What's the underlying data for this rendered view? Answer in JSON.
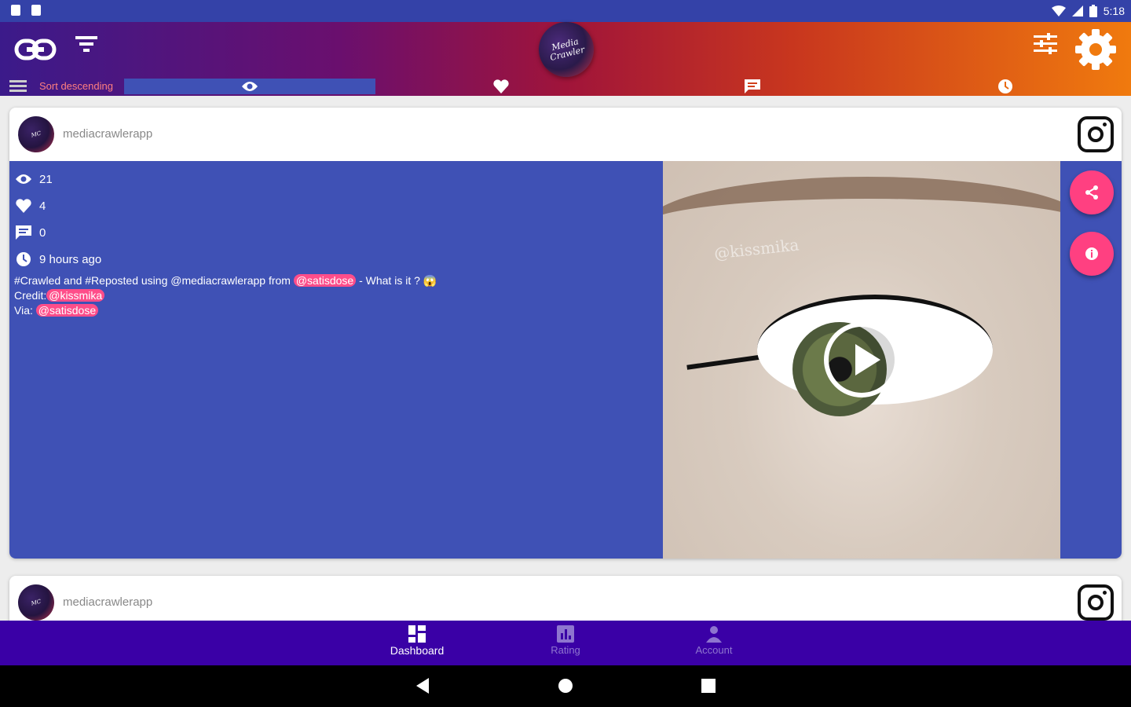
{
  "status_bar": {
    "time": "5:18",
    "left_icons": [
      "sd-card-icon",
      "notification-icon"
    ],
    "right_icons": [
      "wifi-icon",
      "signal-icon",
      "battery-icon"
    ]
  },
  "app_bar": {
    "logo_text": "Media Crawler",
    "left_icons": [
      "link-icon",
      "filter-icon"
    ],
    "right_icons": [
      "tune-icon",
      "gear-icon"
    ],
    "sort_label": "Sort descending",
    "sort_tabs": [
      {
        "name": "views",
        "icon": "eye-icon",
        "active": true
      },
      {
        "name": "likes",
        "icon": "heart-icon",
        "active": false
      },
      {
        "name": "comments",
        "icon": "comment-icon",
        "active": false
      },
      {
        "name": "time",
        "icon": "clock-icon",
        "active": false
      }
    ]
  },
  "posts": [
    {
      "username": "mediacrawlerapp",
      "views": "21",
      "likes": "4",
      "comments": "0",
      "time_ago": "9 hours ago",
      "caption_line1_prefix": "#Crawled and #Reposted using @mediacrawlerapp from ",
      "caption_line1_tag": "@satisdose",
      "caption_line1_suffix": " - What is it ? 😱",
      "caption_credit_prefix": "Credit:",
      "caption_credit_tag": "@kissmika",
      "caption_via_prefix": "Via: ",
      "caption_via_tag": "@satisdose",
      "media_watermark": "@kissmika",
      "media_type": "video"
    },
    {
      "username": "mediacrawlerapp"
    }
  ],
  "colors": {
    "card_bg": "#3f51b5",
    "accent": "#ff4081",
    "bottom_nav": "#3a00a6"
  },
  "bottom_nav": [
    {
      "label": "Dashboard",
      "icon": "dashboard-icon",
      "active": true
    },
    {
      "label": "Rating",
      "icon": "rating-icon",
      "active": false
    },
    {
      "label": "Account",
      "icon": "account-icon",
      "active": false
    }
  ]
}
